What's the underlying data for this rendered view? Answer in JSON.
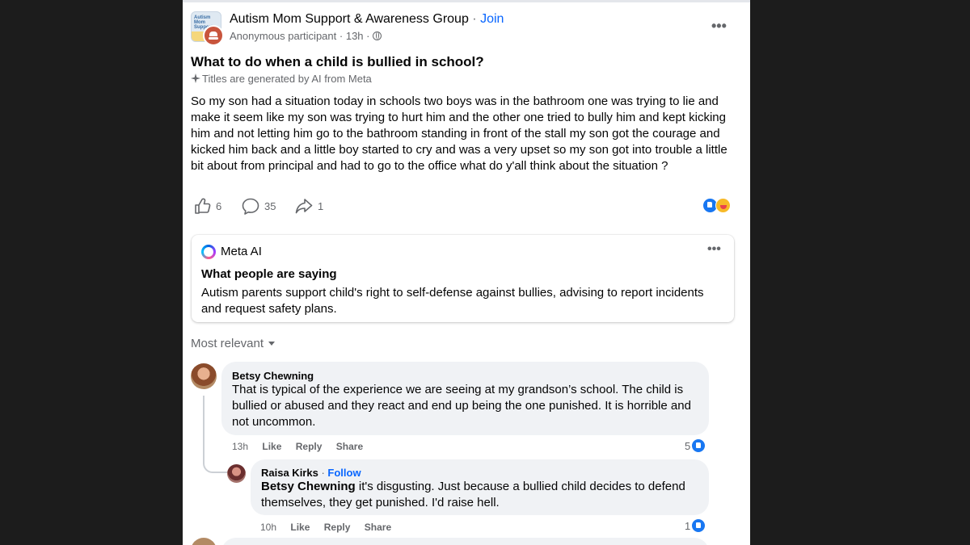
{
  "post": {
    "group_name": "Autism Mom Support & Awareness Group",
    "separator": "·",
    "join_label": "Join",
    "author": "Anonymous participant",
    "time": "13h",
    "group_avatar_text": "Autism Mom Support",
    "title": "What to do when a child is bullied in school?",
    "ai_title_note": "Titles are generated by AI from Meta",
    "body": "So my son had a situation today in schools two boys was in the bathroom one was trying to lie and make it seem like my son was trying to hurt him and the other one tried to bully him and kept kicking him and not letting him go to the bathroom standing in front of the stall my son got the courage and kicked him back and a little boy started to cry and was a very upset so my son got into trouble a little bit about from  principal and had to go to the office what do y'all think about the situation ?",
    "likes": "6",
    "comments": "35",
    "shares": "1",
    "more_label": "•••"
  },
  "meta_ai": {
    "label": "Meta AI",
    "heading": "What people are saying",
    "summary": "Autism parents support child's right to self-defense against bullies, advising to report incidents and request safety plans.",
    "more_label": "•••"
  },
  "sort": {
    "label": "Most relevant"
  },
  "comments": [
    {
      "author": "Betsy Chewning",
      "text": "That is typical of the experience we are seeing at my grandson’s school. The child is bullied or abused and they react and end up being the one punished. It is horrible and not uncommon.",
      "time": "13h",
      "like": "Like",
      "reply": "Reply",
      "share": "Share",
      "reactions": "5"
    },
    {
      "author": "Raisa Kirks",
      "follow": "Follow",
      "mention": "Betsy Chewning",
      "text": " it's disgusting. Just because a bullied child decides to defend themselves, they get punished. I'd raise hell.",
      "time": "10h",
      "like": "Like",
      "reply": "Reply",
      "share": "Share",
      "reactions": "1"
    }
  ],
  "colors": {
    "accent": "#0866ff",
    "secondary_text": "#65676b",
    "bubble": "#f0f2f5",
    "like_blue": "#1877f2"
  },
  "icons": [
    "anonymous-icon",
    "globe-icon",
    "sparkle-icon",
    "like-icon",
    "comment-icon",
    "share-icon",
    "meta-ai-icon",
    "chevron-down-icon"
  ]
}
